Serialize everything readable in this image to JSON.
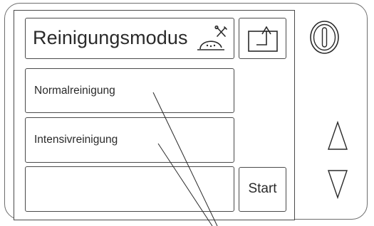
{
  "screen": {
    "title": "Reinigungsmodus",
    "mode_icon": "cleaning-tools-icon",
    "back_icon": "back-arrow-icon",
    "options": [
      {
        "label": "Normalreinigung"
      },
      {
        "label": "Intensivreinigung"
      },
      {
        "label": ""
      }
    ],
    "start_label": "Start"
  },
  "side_controls": {
    "power_icon": "power-icon",
    "up_icon": "up-triangle-icon",
    "down_icon": "down-triangle-icon"
  },
  "colors": {
    "outline": "#4a4a4a",
    "text": "#2a2a2a",
    "background": "#ffffff"
  }
}
